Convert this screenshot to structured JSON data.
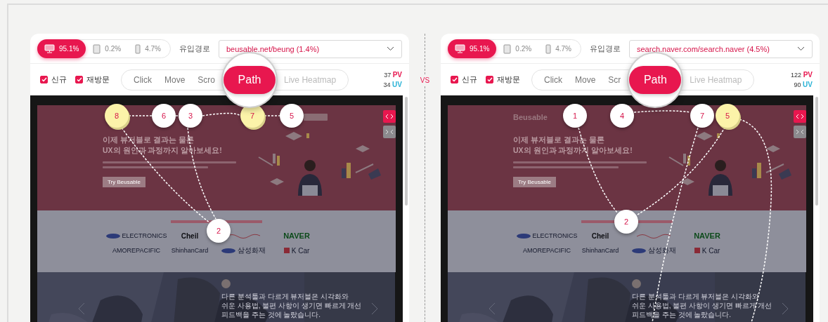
{
  "panels": [
    {
      "devices": [
        {
          "kind": "desktop",
          "share": "95.1%",
          "selected": true
        },
        {
          "kind": "tablet",
          "share": "0.2%",
          "selected": false
        },
        {
          "kind": "mobile",
          "share": "4.7%",
          "selected": false
        }
      ],
      "referrer": {
        "label": "유입경로",
        "value": "beusable.net/beung (1.4%)"
      },
      "filters": [
        {
          "label": "신규",
          "checked": true
        },
        {
          "label": "재방문",
          "checked": true
        }
      ],
      "modes": [
        {
          "label": "Click",
          "selected": false
        },
        {
          "label": "Move",
          "selected": false
        },
        {
          "label": "Scro",
          "selected": false
        },
        {
          "label": "Path",
          "selected": true
        },
        {
          "label": "Live Heatmap",
          "selected": false
        }
      ],
      "stats": [
        {
          "value": "37",
          "unit": "PV",
          "color": "#e8174f"
        },
        {
          "value": "34",
          "unit": "UV",
          "color": "#2ab3d6"
        }
      ],
      "nodes": [
        {
          "label": "8",
          "highlighted": true
        },
        {
          "label": "6",
          "highlighted": false
        },
        {
          "label": "3",
          "highlighted": false
        },
        {
          "label": "7",
          "highlighted": true
        },
        {
          "label": "5",
          "highlighted": false
        },
        {
          "label": "2",
          "highlighted": false
        }
      ],
      "site": {
        "headline": [
          "이제 뷰저블로 결과는 물론",
          "UX의 원인과 과정까지 알아보세요!"
        ],
        "cta": "Try Beusable",
        "logos": [
          [
            "ELECTRONICS",
            "Cheil",
            "NAVER"
          ],
          [
            "AMOREPACIFIC",
            "ShinhanCard",
            "삼성화재",
            "K Car"
          ]
        ],
        "quote": [
          "다른 분석툴과 다르게 뷰저블은 시각화와",
          "쉬운 사용법, 불편 사항이 생기면 빠르게 개선",
          "피드백을 주는 것에 놀랐습니다."
        ]
      }
    },
    {
      "devices": [
        {
          "kind": "desktop",
          "share": "95.1%",
          "selected": true
        },
        {
          "kind": "tablet",
          "share": "0.2%",
          "selected": false
        },
        {
          "kind": "mobile",
          "share": "4.7%",
          "selected": false
        }
      ],
      "referrer": {
        "label": "유입경로",
        "value": "search.naver.com/search.naver (4.5%)"
      },
      "filters": [
        {
          "label": "신규",
          "checked": true
        },
        {
          "label": "재방문",
          "checked": true
        }
      ],
      "modes": [
        {
          "label": "Click",
          "selected": false
        },
        {
          "label": "Move",
          "selected": false
        },
        {
          "label": "Scr",
          "selected": false
        },
        {
          "label": "Path",
          "selected": true
        },
        {
          "label": "Live Heatmap",
          "selected": false
        }
      ],
      "stats": [
        {
          "value": "122",
          "unit": "PV",
          "color": "#e8174f"
        },
        {
          "value": "90",
          "unit": "UV",
          "color": "#2ab3d6"
        }
      ],
      "nodes": [
        {
          "label": "1",
          "highlighted": false
        },
        {
          "label": "4",
          "highlighted": false
        },
        {
          "label": "7",
          "highlighted": false
        },
        {
          "label": "5",
          "highlighted": true
        },
        {
          "label": "2",
          "highlighted": false
        }
      ],
      "site": {
        "brand": "Beusable",
        "headline": [
          "이제 뷰저블로 결과는 물론",
          "UX의 원인과 과정까지 알아보세요!"
        ],
        "cta": "Try Beusable",
        "logos": [
          [
            "ELECTRONICS",
            "Cheil",
            "NAVER"
          ],
          [
            "AMOREPACIFIC",
            "ShinhanCard",
            "삼성화재",
            "K Car"
          ]
        ],
        "quote": [
          "다른 분석툴과 다르게 뷰저블은 시각화와",
          "쉬운 사용법, 불편 사항이 생기면 빠르게 개선",
          "피드백을 주는 것에 놀랐습니다."
        ]
      }
    }
  ],
  "divider": "VS"
}
